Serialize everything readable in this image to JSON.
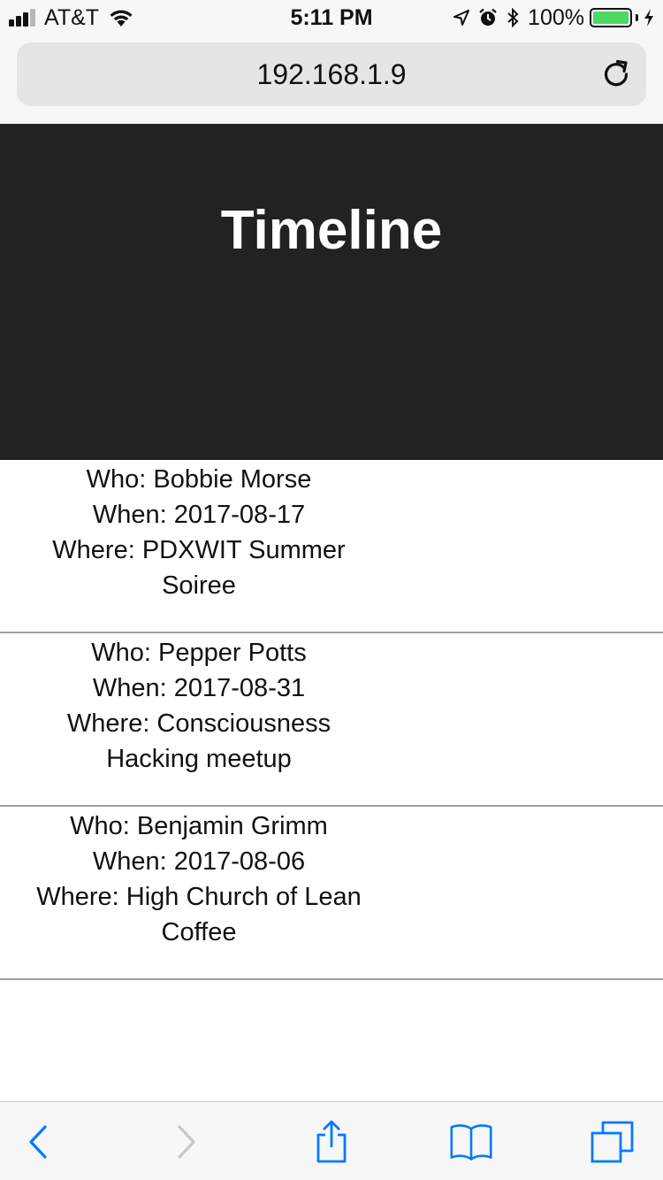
{
  "status_bar": {
    "carrier": "AT&T",
    "time": "5:11 PM",
    "battery_percent": "100%",
    "battery_level": 1.0,
    "signal_bars_filled": 3,
    "signal_bars_total": 4,
    "icons": [
      "signal-icon",
      "wifi-icon",
      "location-arrow-icon",
      "alarm-icon",
      "bluetooth-icon",
      "battery-icon",
      "charging-bolt-icon"
    ]
  },
  "browser": {
    "url": "192.168.1.9",
    "reload_icon": "reload-icon"
  },
  "page": {
    "title": "Timeline"
  },
  "timeline": {
    "entries": [
      {
        "who": "Who: Bobbie Morse",
        "when": "When: 2017-08-17",
        "where": "Where: PDXWIT Summer Soiree"
      },
      {
        "who": "Who: Pepper Potts",
        "when": "When: 2017-08-31",
        "where": "Where: Consciousness Hacking meetup"
      },
      {
        "who": "Who: Benjamin Grimm",
        "when": "When: 2017-08-06",
        "where": "Where: High Church of Lean Coffee"
      }
    ]
  },
  "toolbar": {
    "icons": [
      "back-icon",
      "forward-icon",
      "share-icon",
      "bookmarks-icon",
      "tabs-icon"
    ]
  },
  "colors": {
    "hero_bg": "#222222",
    "hero_text": "#ffffff",
    "accent": "#007aff",
    "disabled": "#c7c7cc",
    "battery_green": "#4cd964",
    "divider": "#a0a0a0"
  }
}
